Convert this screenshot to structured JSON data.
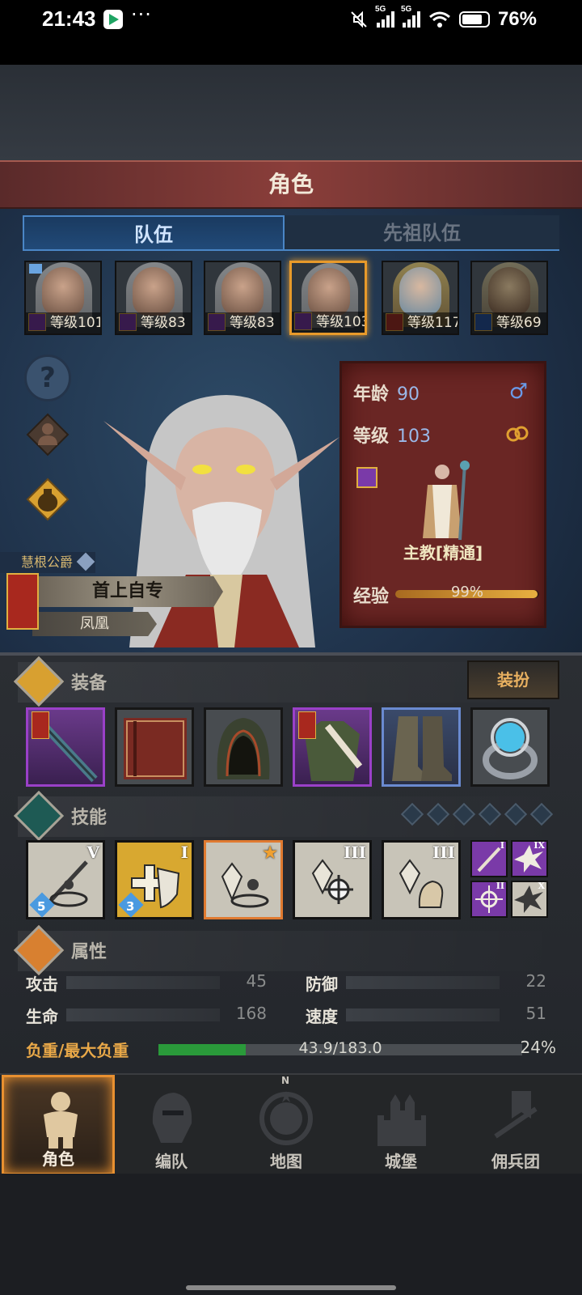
{
  "status_bar": {
    "time": "21:43",
    "dots": "···",
    "network1": "5G",
    "network2": "5G",
    "battery": "76%"
  },
  "header": {
    "title": "角色"
  },
  "tabs": {
    "team": "队伍",
    "ancestor_team": "先祖队伍"
  },
  "heroes": [
    {
      "level": "等级101",
      "class_color": "#7a3aa8",
      "selected": false
    },
    {
      "level": "等级83",
      "class_color": "#7a3aa8",
      "selected": false
    },
    {
      "level": "等级83",
      "class_color": "#7a3aa8",
      "selected": false
    },
    {
      "level": "等级103",
      "class_color": "#7a3aa8",
      "selected": true
    },
    {
      "level": "等级117",
      "class_color": "#a8342a",
      "selected": false
    },
    {
      "level": "等级69",
      "class_color": "#2a5aa8",
      "selected": false
    }
  ],
  "side_buttons": {
    "help_glyph": "?"
  },
  "stats_card": {
    "age_label": "年龄",
    "age": "90",
    "level_label": "等级",
    "level": "103",
    "class_name": "主教[精通]",
    "exp_label": "经验",
    "exp_text": "99%",
    "exp_fraction": 0.99
  },
  "character": {
    "title": "慧根公爵",
    "name": "首上自专",
    "subtitle": "凤凰"
  },
  "equipment": {
    "title": "装备",
    "dress_button": "装扮"
  },
  "skills": {
    "title": "技能",
    "slots": [
      {
        "numeral": "V",
        "count": "5"
      },
      {
        "numeral": "I",
        "count": "3"
      },
      {
        "numeral": "★",
        "count": ""
      },
      {
        "numeral": "III",
        "count": ""
      },
      {
        "numeral": "III",
        "count": ""
      }
    ],
    "mini": [
      {
        "numeral": "I"
      },
      {
        "numeral": "IX"
      },
      {
        "numeral": "II"
      },
      {
        "numeral": "X"
      }
    ]
  },
  "attributes": {
    "title": "属性",
    "attack_label": "攻击",
    "attack": "45",
    "defense_label": "防御",
    "defense": "22",
    "hp_label": "生命",
    "hp": "168",
    "speed_label": "速度",
    "speed": "51",
    "weight_label": "负重/最大负重",
    "weight_text": "43.9/183.0",
    "weight_pct": "24%",
    "weight_fraction": 0.24
  },
  "nav": {
    "character": "角色",
    "formation": "编队",
    "map": "地图",
    "castle": "城堡",
    "mercenary": "佣兵团",
    "compass_n": "N"
  },
  "colors": {
    "accent": "#e89030",
    "tab_active": "#4a86c6",
    "header": "#8a3e3a"
  }
}
